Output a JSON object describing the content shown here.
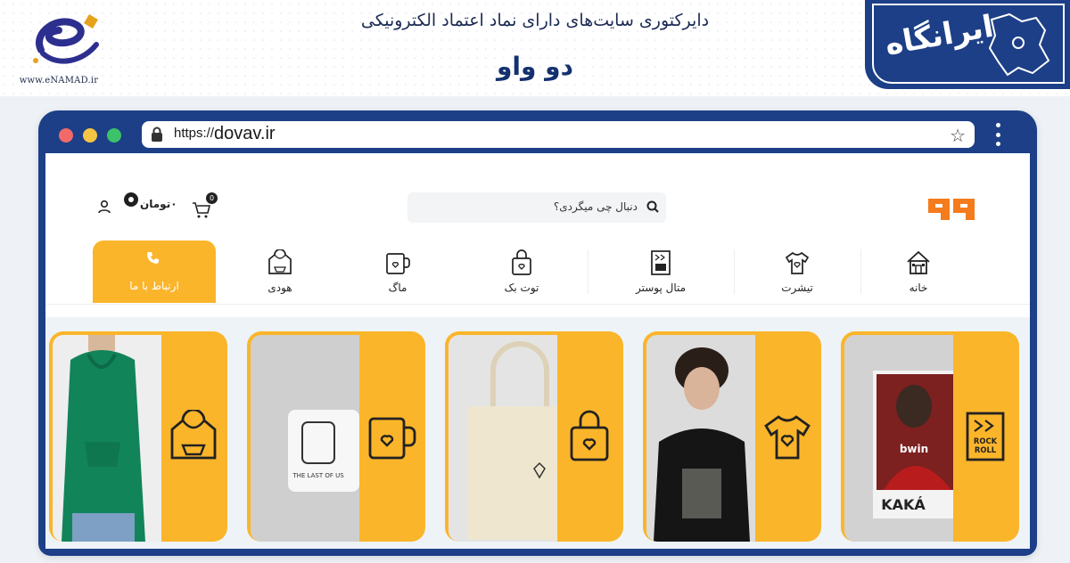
{
  "banner": {
    "enamad_url": "www.eNAMAD.ir",
    "subtitle": "دایرکتوری سایت‌های دارای نماد اعتماد الکترونیکی",
    "title": "دو واو",
    "brand_text": "ایرانگاه"
  },
  "browser": {
    "url_scheme": "https://",
    "url_host": "dovav.ir"
  },
  "site": {
    "search_placeholder": "دنبال چی میگردی؟",
    "currency_label": "۰تومان",
    "cart_count": "0"
  },
  "nav": {
    "items": [
      {
        "label": "خانه",
        "icon": "home-icon"
      },
      {
        "label": "تیشرت",
        "icon": "tshirt-icon"
      },
      {
        "label": "متال پوستر",
        "icon": "poster-icon"
      },
      {
        "label": "توت بک",
        "icon": "tote-bag-icon"
      },
      {
        "label": "ماگ",
        "icon": "mug-icon"
      },
      {
        "label": "هودی",
        "icon": "hoodie-icon"
      }
    ],
    "contact_label": "ارتباط با ما"
  },
  "poster_text": {
    "top": "ROCK",
    "bottom": "ROLL",
    "player": "KAKÁ",
    "sponsor": "bwin",
    "mug_caption": "THE LAST OF US"
  },
  "colors": {
    "accent": "#fbb52a",
    "frame": "#1c3f87",
    "strip": "#eef3f8"
  }
}
